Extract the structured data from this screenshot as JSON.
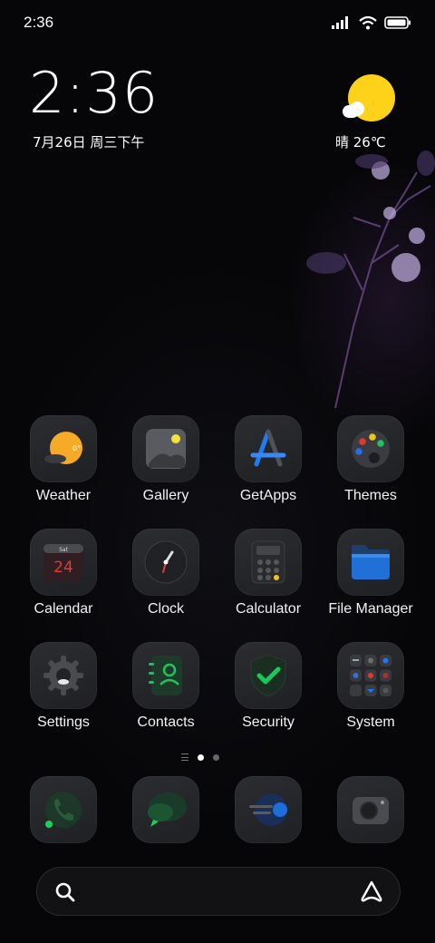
{
  "status_bar": {
    "time": "2:36",
    "icons": [
      "signal-icon",
      "wifi-icon",
      "battery-icon"
    ]
  },
  "clock_widget": {
    "time": "2:36",
    "date": "7月26日 周三下午"
  },
  "weather_widget": {
    "icon": "sunny-cloud-icon",
    "text": "晴 26℃"
  },
  "apps": [
    {
      "label": "Weather",
      "icon": "weather-icon"
    },
    {
      "label": "Gallery",
      "icon": "gallery-icon"
    },
    {
      "label": "GetApps",
      "icon": "getapps-icon"
    },
    {
      "label": "Themes",
      "icon": "themes-icon"
    },
    {
      "label": "Calendar",
      "icon": "calendar-icon",
      "day": "24",
      "weekday": "Sat"
    },
    {
      "label": "Clock",
      "icon": "clock-icon"
    },
    {
      "label": "Calculator",
      "icon": "calculator-icon"
    },
    {
      "label": "File Manager",
      "icon": "file-manager-icon"
    },
    {
      "label": "Settings",
      "icon": "settings-icon"
    },
    {
      "label": "Contacts",
      "icon": "contacts-icon"
    },
    {
      "label": "Security",
      "icon": "security-icon"
    },
    {
      "label": "System",
      "icon": "system-folder-icon"
    }
  ],
  "pager": {
    "pages": 2,
    "current": 1
  },
  "dock": [
    {
      "icon": "phone-icon"
    },
    {
      "icon": "messages-icon"
    },
    {
      "icon": "browser-icon"
    },
    {
      "icon": "camera-icon"
    }
  ],
  "search": {
    "icon": "search-icon",
    "assistant_icon": "assistant-icon"
  },
  "colors": {
    "accent_sun": "#ffd21a",
    "security_green": "#16c95a",
    "calendar_red": "#e53935"
  }
}
